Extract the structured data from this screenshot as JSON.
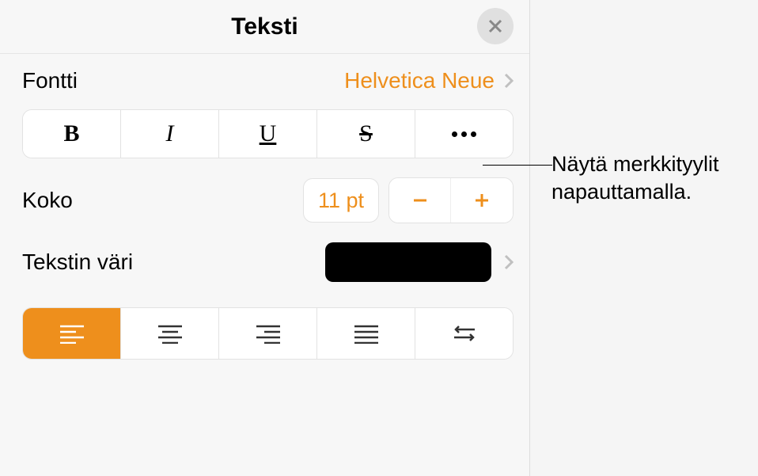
{
  "header": {
    "title": "Teksti"
  },
  "font": {
    "label": "Fontti",
    "value": "Helvetica Neue"
  },
  "size": {
    "label": "Koko",
    "value": "11 pt"
  },
  "textColor": {
    "label": "Tekstin väri",
    "swatch": "#000000"
  },
  "callout": {
    "text": "Näytä merkkityylit napauttamalla."
  }
}
